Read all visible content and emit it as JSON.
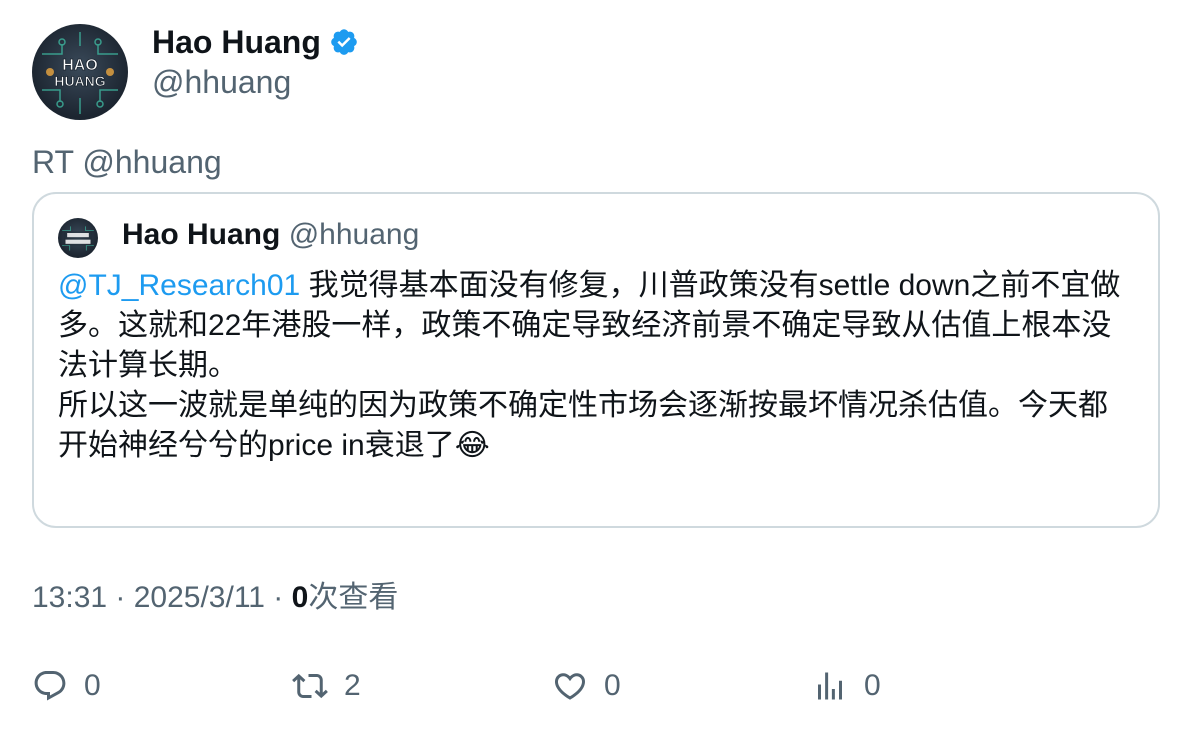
{
  "author": {
    "name": "Hao Huang",
    "handle": "@hhuang",
    "avatar_text_line1": "HAO",
    "avatar_text_line2": "HUANG",
    "verified_color": "#1d9bf0"
  },
  "retweet_label": "RT @hhuang",
  "quoted_tweet": {
    "name": "Hao Huang",
    "handle": "@hhuang",
    "mention": "@TJ_Research01",
    "text_part1": " 我觉得基本面没有修复，川普政策没有settle down之前不宜做多。这就和22年港股一样，政策不确定导致经济前景不确定导致从估值上根本没法计算长期。",
    "text_part2": "所以这一波就是单纯的因为政策不确定性市场会逐渐按最坏情况杀估值。今天都开始神经兮兮的price in衰退了😂"
  },
  "meta": {
    "timestamp": "13:31 · 2025/3/11 · ",
    "views_count": "0",
    "views_label": "次查看"
  },
  "actions": {
    "reply_count": "0",
    "retweet_count": "2",
    "like_count": "0",
    "views_count": "0"
  },
  "colors": {
    "text_primary": "#0f1419",
    "text_secondary": "#536471",
    "link": "#1d9bf0",
    "border": "#cfd9de"
  }
}
